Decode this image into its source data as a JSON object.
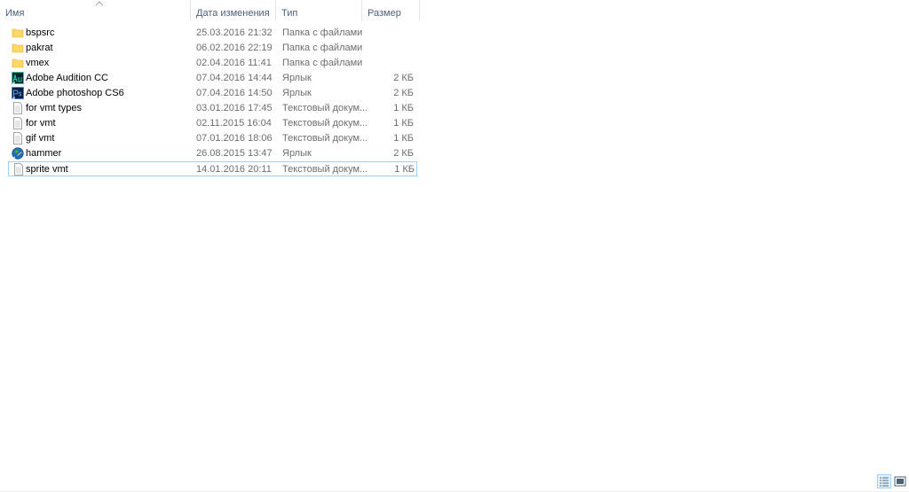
{
  "columns": {
    "name": "Имя",
    "date": "Дата изменения",
    "type": "Тип",
    "size": "Размер"
  },
  "files": [
    {
      "name": "bspsrc",
      "date": "25.03.2016 21:32",
      "type": "Папка с файлами",
      "size": "",
      "icon": "folder-icon"
    },
    {
      "name": "pakrat",
      "date": "06.02.2016 22:19",
      "type": "Папка с файлами",
      "size": "",
      "icon": "folder-icon"
    },
    {
      "name": "vmex",
      "date": "02.04.2016 11:41",
      "type": "Папка с файлами",
      "size": "",
      "icon": "folder-icon"
    },
    {
      "name": "Adobe Audition CC",
      "date": "07.04.2016 14:44",
      "type": "Ярлык",
      "size": "2 КБ",
      "icon": "audition-icon"
    },
    {
      "name": "Adobe photoshop CS6",
      "date": "07.04.2016 14:50",
      "type": "Ярлык",
      "size": "2 КБ",
      "icon": "photoshop-icon"
    },
    {
      "name": "for vmt types",
      "date": "03.01.2016 17:45",
      "type": "Текстовый докум...",
      "size": "1 КБ",
      "icon": "text-file-icon"
    },
    {
      "name": "for vmt",
      "date": "02.11.2015 16:04",
      "type": "Текстовый докум...",
      "size": "1 КБ",
      "icon": "text-file-icon"
    },
    {
      "name": "gif vmt",
      "date": "07.01.2016 18:06",
      "type": "Текстовый докум...",
      "size": "1 КБ",
      "icon": "text-file-icon"
    },
    {
      "name": "hammer",
      "date": "26.08.2015 13:47",
      "type": "Ярлык",
      "size": "2 КБ",
      "icon": "hammer-icon"
    },
    {
      "name": "sprite vmt",
      "date": "14.01.2016 20:11",
      "type": "Текстовый докум...",
      "size": "1 КБ",
      "icon": "text-file-icon"
    }
  ],
  "colors": {
    "header_text": "#4c607a",
    "detail_text": "#6d6d6d",
    "selection_border": "#99d1ff",
    "folder": "#ffd764"
  }
}
